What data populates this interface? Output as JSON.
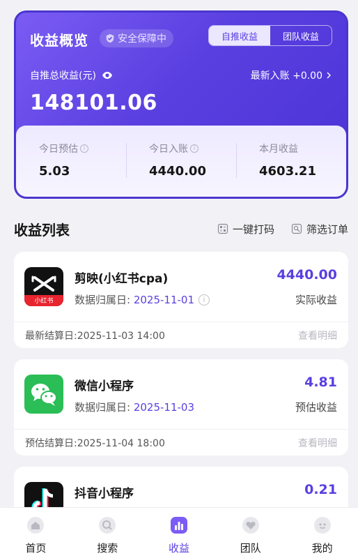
{
  "header": {
    "title": "收益概览",
    "safety_badge": "安全保障中",
    "tabs": [
      {
        "label": "自推收益",
        "active": true
      },
      {
        "label": "团队收益",
        "active": false
      }
    ],
    "total_label": "自推总收益(元)",
    "latest_entry": "最新入账 +0.00",
    "total_value": "148101.06",
    "stats": [
      {
        "label": "今日预估",
        "value": "5.03",
        "has_info": true
      },
      {
        "label": "今日入账",
        "value": "4440.00",
        "has_info": true
      },
      {
        "label": "本月收益",
        "value": "4603.21",
        "has_info": false
      }
    ]
  },
  "list": {
    "title": "收益列表",
    "actions": [
      "一键打码",
      "筛选订单"
    ],
    "date_prefix": "数据归属日: ",
    "detail_label": "查看明细",
    "items": [
      {
        "name": "剪映(小红书cpa)",
        "date": "2025-11-01",
        "amount": "4440.00",
        "kind": "实际收益",
        "footer": "最新结算日:2025-11-03 14:00",
        "logo": "capcut-xiaohongshu-logo",
        "logo_text": "小红书"
      },
      {
        "name": "微信小程序",
        "date": "2025-11-03",
        "amount": "4.81",
        "kind": "预估收益",
        "footer": "预估结算日:2025-11-04 18:00",
        "logo": "wechat-logo"
      },
      {
        "name": "抖音小程序",
        "amount": "0.21",
        "logo": "douyin-logo"
      }
    ]
  },
  "tabbar": {
    "items": [
      {
        "label": "首页",
        "icon": "home-icon",
        "active": false
      },
      {
        "label": "搜索",
        "icon": "search-icon",
        "active": false
      },
      {
        "label": "收益",
        "icon": "chart-icon",
        "active": true
      },
      {
        "label": "团队",
        "icon": "team-icon",
        "active": false
      },
      {
        "label": "我的",
        "icon": "profile-icon",
        "active": false
      }
    ]
  },
  "colors": {
    "accent": "#5a3fe0",
    "background": "#f2f2f6",
    "hero_gradient_start": "#7b5cf4",
    "hero_gradient_end": "#4b33d6",
    "muted_text": "#8a8a9a"
  }
}
